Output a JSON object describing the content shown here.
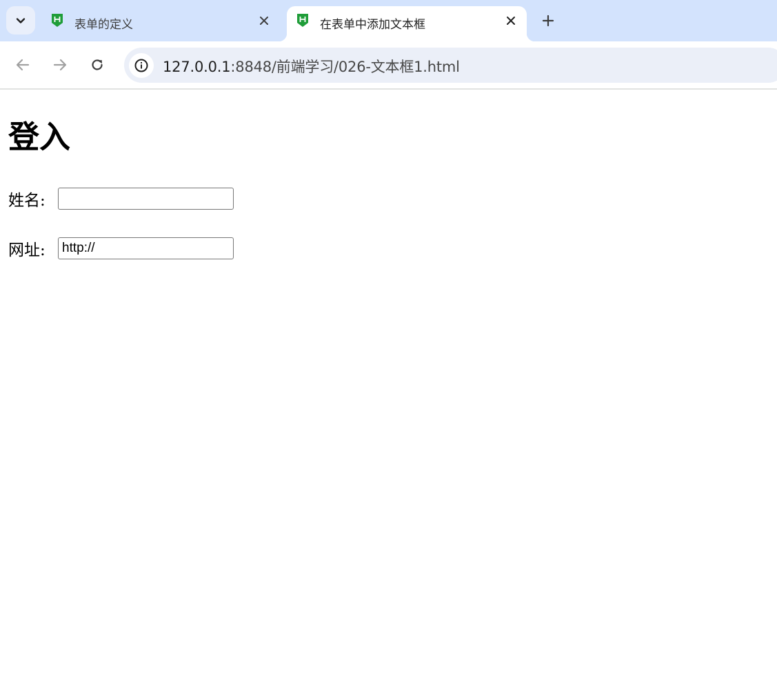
{
  "browser": {
    "tabs": [
      {
        "title": "表单的定义",
        "active": false,
        "favicon": "hbuilder-html-icon"
      },
      {
        "title": "在表单中添加文本框",
        "active": true,
        "favicon": "hbuilder-html-icon"
      }
    ],
    "address_bar": {
      "url_host": "127.0.0.1",
      "url_rest": ":8848/前端学习/026-文本框1.html"
    }
  },
  "page": {
    "heading": "登入",
    "fields": [
      {
        "label": "姓名:",
        "value": ""
      },
      {
        "label": "网址:",
        "value": "http://"
      }
    ]
  },
  "colors": {
    "tabstrip_bg": "#d3e3fd",
    "omnibox_bg": "#ebeff8",
    "favicon_green": "#1f9d39"
  }
}
